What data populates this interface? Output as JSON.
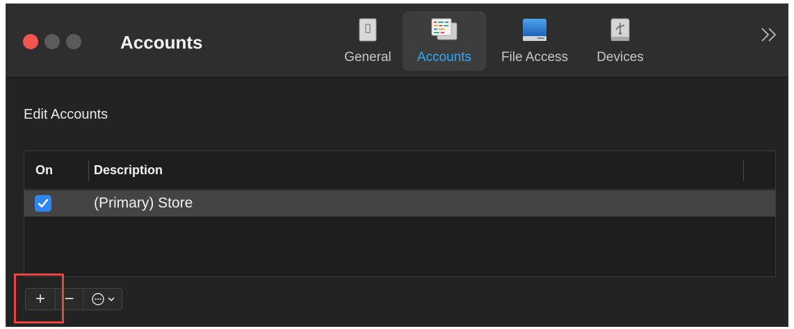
{
  "window": {
    "title": "Accounts"
  },
  "tabs": [
    {
      "label": "General",
      "icon": "general-icon",
      "selected": false
    },
    {
      "label": "Accounts",
      "icon": "accounts-icon",
      "selected": true
    },
    {
      "label": "File Access",
      "icon": "file-access-icon",
      "selected": false
    },
    {
      "label": "Devices",
      "icon": "devices-icon",
      "selected": false
    }
  ],
  "overflow": {
    "label": "»",
    "icon": "chevron-double-right-icon"
  },
  "section": {
    "title": "Edit Accounts"
  },
  "table": {
    "columns": [
      "On",
      "Description"
    ],
    "rows": [
      {
        "on": true,
        "description": "(Primary) Store"
      }
    ]
  },
  "toolbar": {
    "add_label": "+",
    "remove_label": "−",
    "more_icon": "ellipsis-circle-icon",
    "dropdown_icon": "chevron-down-icon"
  },
  "colors": {
    "accent": "#38a8f5",
    "checkbox": "#2f86f0",
    "highlight": "#e8463f",
    "close": "#f0564f"
  }
}
